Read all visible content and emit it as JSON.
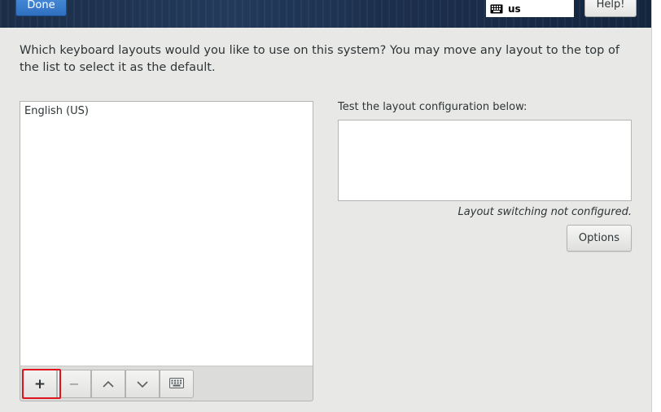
{
  "header": {
    "done_label": "Done",
    "keyboard_indicator": "us",
    "help_label": "Help!"
  },
  "intro_text": "Which keyboard layouts would you like to use on this system?  You may move any layout to the top of the list to select it as the default.",
  "layouts": {
    "items": [
      {
        "label": "English (US)"
      }
    ]
  },
  "toolbar": {
    "add_label": "+",
    "remove_label": "−",
    "up_icon": "chevron-up-icon",
    "down_icon": "chevron-down-icon",
    "preview_icon": "keyboard-icon"
  },
  "test": {
    "label": "Test the layout configuration below:",
    "value": ""
  },
  "switch_status": "Layout switching not configured.",
  "options_label": "Options",
  "colors": {
    "done_button": "#3b7fd0",
    "highlight": "#e0141c",
    "header": "#1f3452"
  }
}
